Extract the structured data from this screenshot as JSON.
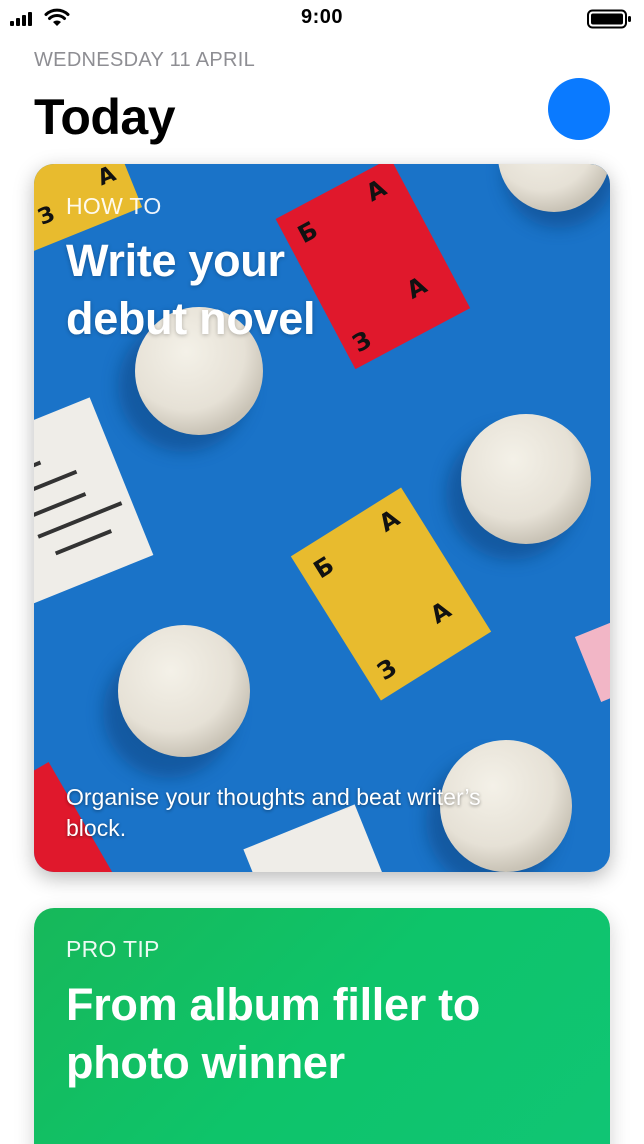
{
  "status_bar": {
    "time": "9:00",
    "icons": [
      "signal-icon",
      "wifi-icon",
      "battery-icon"
    ]
  },
  "header": {
    "date": "WEDNESDAY 11 APRIL",
    "title": "Today",
    "avatar_icon": "account-avatar"
  },
  "colors": {
    "accent": "#0a7aff",
    "card1_background": "#1a73c8",
    "card2_background": "#10c06a"
  },
  "cards": [
    {
      "eyebrow": "HOW TO",
      "headline": "Write your debut novel",
      "summary": "Organise your thoughts and beat writer’s block."
    },
    {
      "eyebrow": "PRO TIP",
      "headline": "From album filler to photo winner"
    }
  ]
}
